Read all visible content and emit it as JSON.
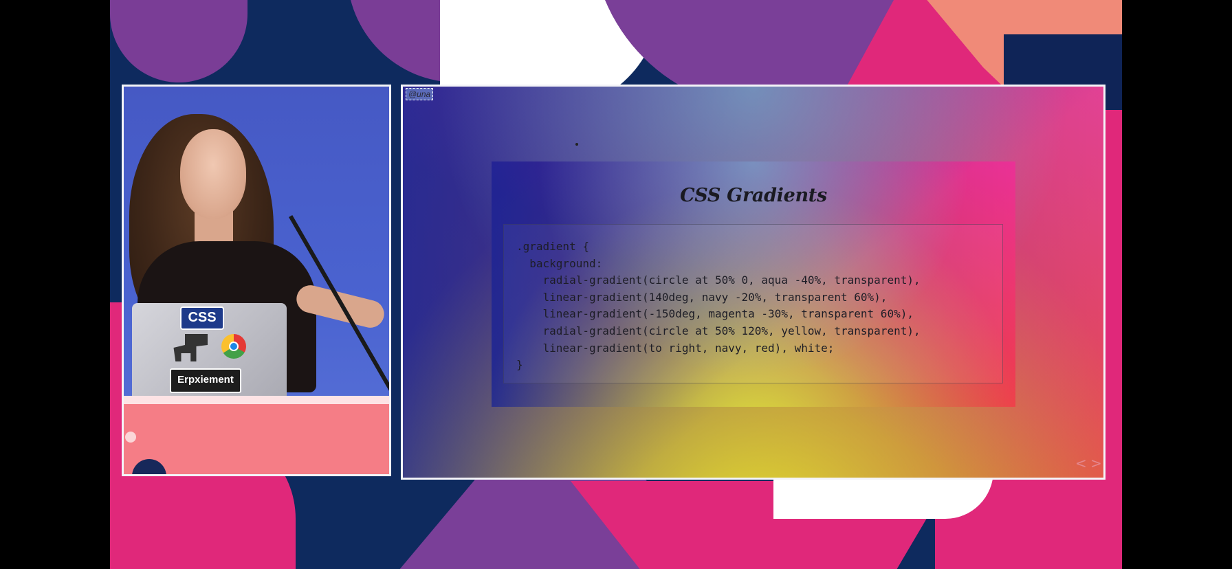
{
  "slide": {
    "handle": "@una",
    "title": "CSS Gradients",
    "code_lines": [
      ".gradient {",
      "  background:",
      "    radial-gradient(circle at 50% 0, aqua -40%, transparent),",
      "    linear-gradient(140deg, navy -20%, transparent 60%),",
      "    linear-gradient(-150deg, magenta -30%, transparent 60%),",
      "    radial-gradient(circle at 50% 120%, yellow, transparent),",
      "    linear-gradient(to right, navy, red), white;",
      "}"
    ],
    "nav_prev": "<",
    "nav_next": ">"
  },
  "speaker": {
    "laptop_stickers": {
      "css": "CSS",
      "experiment": "Erpxiement"
    }
  },
  "colors": {
    "background_navy": "#0e2a5e",
    "accent_pink": "#e0287a",
    "accent_purple": "#7a3f98",
    "accent_salmon": "#f08a78",
    "panel_border": "#f4f4f8"
  }
}
